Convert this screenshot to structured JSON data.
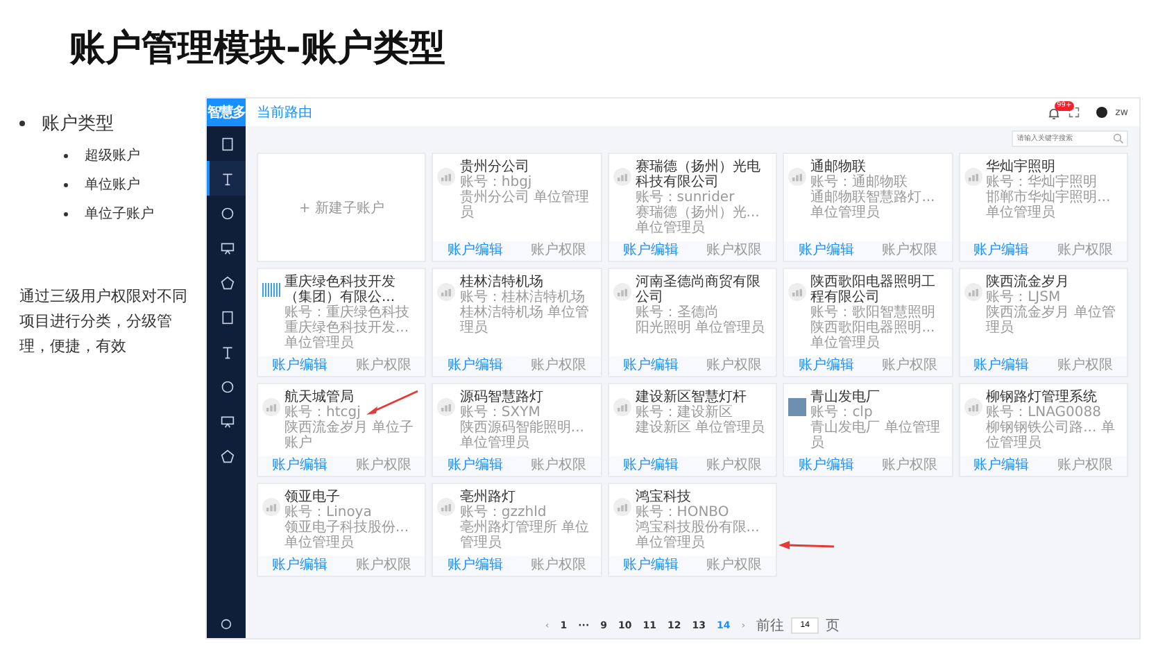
{
  "slide": {
    "title": "账户管理模块-账户类型",
    "bullets": [
      {
        "text": "账户类型",
        "children": [
          {
            "text": "超级账户"
          },
          {
            "text": "单位账户"
          },
          {
            "text": "单位子账户"
          }
        ]
      }
    ],
    "note": "通过三级用户权限对不同项目进行分类，分级管理，便捷，有效"
  },
  "app": {
    "logo": "智慧多",
    "breadcrumb": "当前路由",
    "notification_badge": "99+",
    "user_name": "zw",
    "sidebar": {
      "items": [
        {
          "selected": false
        },
        {
          "selected": true
        },
        {
          "selected": false
        },
        {
          "selected": false
        },
        {
          "selected": false
        },
        {
          "selected": false
        },
        {
          "selected": false
        },
        {
          "selected": false
        },
        {
          "selected": false
        },
        {
          "selected": false
        }
      ]
    },
    "search": {
      "placeholder": "请输入关键字搜索"
    },
    "new_card": {
      "label": "+ 新建子账户"
    },
    "accounts": [
      {
        "kind": "avatar",
        "name": "贵州分公司",
        "account": "账号：hbgj",
        "description": "贵州分公司 单位管理员",
        "actions": [
          "账户编辑",
          "账户权限"
        ]
      },
      {
        "kind": "avatar",
        "name": "赛瑞德（扬州）光电科技有限公司",
        "account": "账号：sunrider",
        "description": "赛瑞德（扬州）光... 单位管理员",
        "actions": [
          "账户编辑",
          "账户权限"
        ]
      },
      {
        "kind": "avatar",
        "name": "通邮物联",
        "account": "账号：通邮物联",
        "description": "通邮物联智慧路灯... 单位管理员",
        "actions": [
          "账户编辑",
          "账户权限"
        ]
      },
      {
        "kind": "avatar",
        "name": "华灿宇照明",
        "account": "账号：华灿宇照明",
        "description": "邯郸市华灿宇照明... 单位管理员",
        "actions": [
          "账户编辑",
          "账户权限"
        ]
      },
      {
        "kind": "logo",
        "name": "重庆绿色科技开发（集团）有限公...",
        "account": "账号：重庆绿色科技",
        "description": "重庆绿色科技开发... 单位管理员",
        "actions": [
          "账户编辑",
          "账户权限"
        ]
      },
      {
        "kind": "avatar",
        "name": "桂林洁特机场",
        "account": "账号：桂林洁特机场",
        "description": "桂林洁特机场 单位管理员",
        "actions": [
          "账户编辑",
          "账户权限"
        ]
      },
      {
        "kind": "avatar",
        "name": "河南圣德尚商贸有限公司",
        "account": "账号：圣德尚",
        "description": "阳光照明 单位管理员",
        "actions": [
          "账户编辑",
          "账户权限"
        ]
      },
      {
        "kind": "avatar",
        "name": "陕西歌阳电器照明工程有限公司",
        "account": "账号：歌阳智慧照明",
        "description": "陕西歌阳电器照明... 单位管理员",
        "actions": [
          "账户编辑",
          "账户权限"
        ]
      },
      {
        "kind": "avatar",
        "name": "陕西流金岁月",
        "account": "账号：LJSM",
        "description": "陕西流金岁月 单位管理员",
        "actions": [
          "账户编辑",
          "账户权限"
        ]
      },
      {
        "kind": "avatar",
        "name": "航天城管局",
        "account": "账号：htcgj",
        "description": "陕西流金岁月 单位子账户",
        "actions": [
          "账户编辑",
          "账户权限"
        ],
        "arrow": {
          "kind": "diagonal"
        }
      },
      {
        "kind": "avatar",
        "name": "源码智慧路灯",
        "account": "账号：SXYM",
        "description": "陕西源码智能照明... 单位管理员",
        "actions": [
          "账户编辑",
          "账户权限"
        ]
      },
      {
        "kind": "avatar",
        "name": "建设新区智慧灯杆",
        "account": "账号：建设新区",
        "description": "建设新区 单位管理员",
        "actions": [
          "账户编辑",
          "账户权限"
        ]
      },
      {
        "kind": "photo",
        "name": "青山发电厂",
        "account": "账号：clp",
        "description": "青山发电厂 单位管理员",
        "actions": [
          "账户编辑",
          "账户权限"
        ]
      },
      {
        "kind": "avatar",
        "name": "柳钢路灯管理系统",
        "account": "账号：LNAG0088",
        "description": "柳钢钢铁公司路... 单位管理员",
        "actions": [
          "账户编辑",
          "账户权限"
        ]
      },
      {
        "kind": "avatar",
        "name": "领亚电子",
        "account": "账号：Linoya",
        "description": "领亚电子科技股份... 单位管理员",
        "actions": [
          "账户编辑",
          "账户权限"
        ]
      },
      {
        "kind": "avatar",
        "name": "亳州路灯",
        "account": "账号：gzzhld",
        "description": "亳州路灯管理所 单位管理员",
        "actions": [
          "账户编辑",
          "账户权限"
        ]
      },
      {
        "kind": "avatar",
        "name": "鸿宝科技",
        "account": "账号：HONBO",
        "description": "鸿宝科技股份有限... 单位管理员",
        "actions": [
          "账户编辑",
          "账户权限"
        ],
        "arrow": {
          "kind": "horizontal"
        }
      }
    ],
    "pagination": {
      "prev": "‹",
      "pages": [
        {
          "label": "1",
          "selected": false
        },
        {
          "label": "···",
          "selected": false
        },
        {
          "label": "9",
          "selected": false
        },
        {
          "label": "10",
          "selected": false
        },
        {
          "label": "11",
          "selected": false
        },
        {
          "label": "12",
          "selected": false
        },
        {
          "label": "13",
          "selected": false
        },
        {
          "label": "14",
          "selected": true
        }
      ],
      "next": "›",
      "goto_label": "前往",
      "goto_value": "14",
      "page_unit": "页"
    }
  }
}
